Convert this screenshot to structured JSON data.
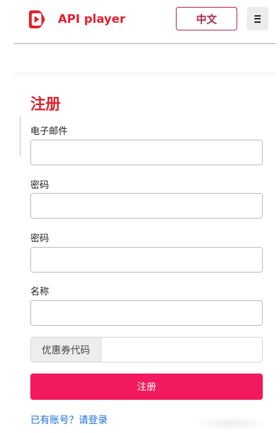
{
  "brand": {
    "name": "API player",
    "logo_icon": "play-logo-icon",
    "color": "#e0202e"
  },
  "header": {
    "lang_button_label": "中文",
    "menu_icon": "hamburger-menu-icon"
  },
  "form": {
    "title": "注册",
    "email_label": "电子邮件",
    "email_value": "",
    "password_label": "密码",
    "password_value": "",
    "confirm_password_label": "密码",
    "confirm_password_value": "",
    "name_label": "名称",
    "name_value": "",
    "coupon_addon": "优惠券代码",
    "coupon_value": "",
    "submit_label": "注册",
    "login_link": "已有账号？请登录"
  },
  "colors": {
    "accent": "#f2195e",
    "title": "#e0202e",
    "link": "#1a6fe0",
    "lang_border": "#b0214a"
  }
}
